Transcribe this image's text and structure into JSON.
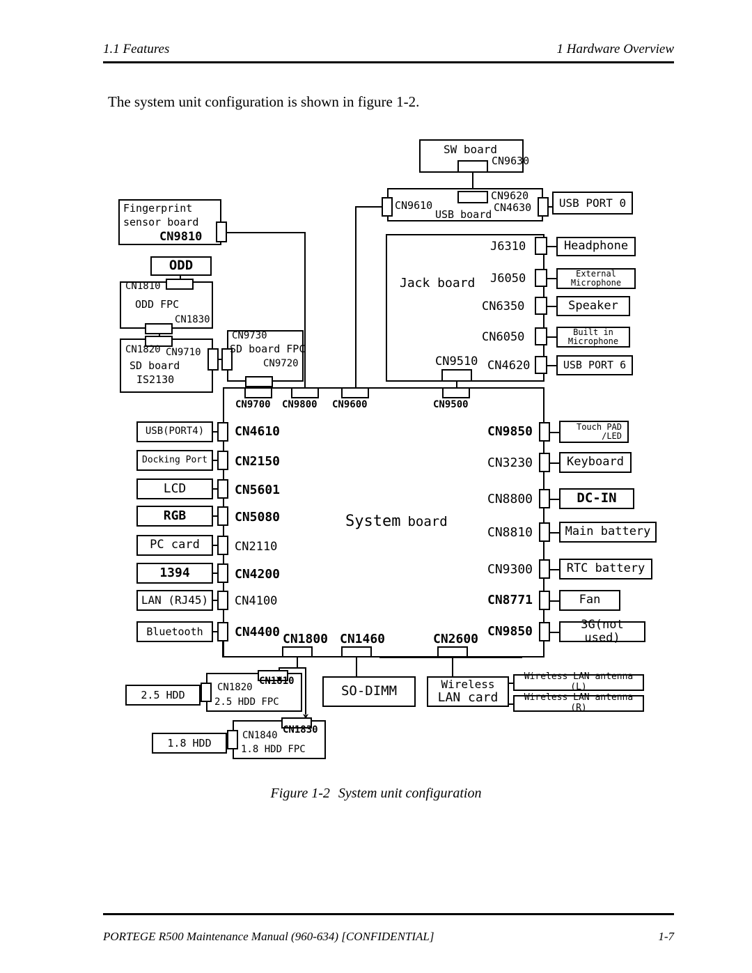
{
  "page": {
    "header_left": "1.1 Features",
    "header_right": "1  Hardware Overview",
    "intro": "The system unit configuration is shown in figure 1-2.",
    "caption_number": "Figure 1-2",
    "caption_title": "System unit configuration",
    "footer_left": "PORTEGE R500 Maintenance Manual (960-634) [CONFIDENTIAL]",
    "footer_right": "1-7"
  },
  "diagram": {
    "boards": {
      "sw_board": "SW board",
      "usb_board": "USB board",
      "jack_board": "Jack board",
      "system_board_a": "System",
      "system_board_b": "board",
      "fingerprint_line1": "Fingerprint",
      "fingerprint_line2": "sensor board",
      "odd_fpc": "ODD FPC",
      "sd_board_fpc": "SD board FPC",
      "sd_board_line1": "SD board",
      "sd_board_line2": "IS2130",
      "hdd25_fpc": "2.5 HDD FPC",
      "hdd18_fpc": "1.8 HDD FPC",
      "wireless_lan_card_line1": "Wireless",
      "wireless_lan_card_line2": "LAN card"
    },
    "devices": {
      "usb_port_0": "USB PORT 0",
      "headphone": "Headphone",
      "external_mic_line1": "External",
      "external_mic_line2": "Microphone",
      "speaker": "Speaker",
      "builtin_mic_line1": "Built in",
      "builtin_mic_line2": "Microphone",
      "usb_port_6": "USB PORT 6",
      "odd": "ODD",
      "usb_port4": "USB(PORT4)",
      "docking_port": "Docking Port",
      "lcd": "LCD",
      "rgb": "RGB",
      "pc_card": "PC card",
      "ieee1394": "1394",
      "lan_rj45": "LAN (RJ45)",
      "bluetooth": "Bluetooth",
      "touch_pad_line1": "Touch PAD",
      "touch_pad_line2": "/LED",
      "keyboard": "Keyboard",
      "dc_in": "DC-IN",
      "main_battery": "Main battery",
      "rtc_battery": "RTC battery",
      "fan": "Fan",
      "three_g": "3G(not used)",
      "hdd25": "2.5 HDD",
      "hdd18": "1.8 HDD",
      "so_dimm": "SO-DIMM",
      "wlan_antenna_l": "Wireless LAN antenna (L)",
      "wlan_antenna_r": "Wireless LAN antenna (R)"
    },
    "connectors": {
      "cn9630": "CN9630",
      "cn9610": "CN9610",
      "cn9620": "CN9620",
      "cn4630": "CN4630",
      "j6310": "J6310",
      "j6050": "J6050",
      "cn6350": "CN6350",
      "cn6050": "CN6050",
      "cn9510": "CN9510",
      "cn4620": "CN4620",
      "cn9810": "CN9810",
      "cn1810_odd": "CN1810",
      "cn1830_odd": "CN1830",
      "cn1820_sd": "CN1820",
      "cn9710": "CN9710",
      "cn9730": "CN9730",
      "cn9720": "CN9720",
      "cn9700": "CN9700",
      "cn9800": "CN9800",
      "cn9600": "CN9600",
      "cn9500": "CN9500",
      "cn4610": "CN4610",
      "cn2150": "CN2150",
      "cn5601": "CN5601",
      "cn5080": "CN5080",
      "cn2110": "CN2110",
      "cn4200": "CN4200",
      "cn4100": "CN4100",
      "cn4400": "CN4400",
      "cn9850_touchpad": "CN9850",
      "cn3230": "CN3230",
      "cn8800": "CN8800",
      "cn8810": "CN8810",
      "cn9300": "CN9300",
      "cn8771": "CN8771",
      "cn9850_3g": "CN9850",
      "cn1800": "CN1800",
      "cn1460": "CN1460",
      "cn2600": "CN2600",
      "cn1810_hdd": "CN1810",
      "cn1820_hdd": "CN1820",
      "cn1830_hdd": "CN1830",
      "cn1840": "CN1840"
    }
  }
}
